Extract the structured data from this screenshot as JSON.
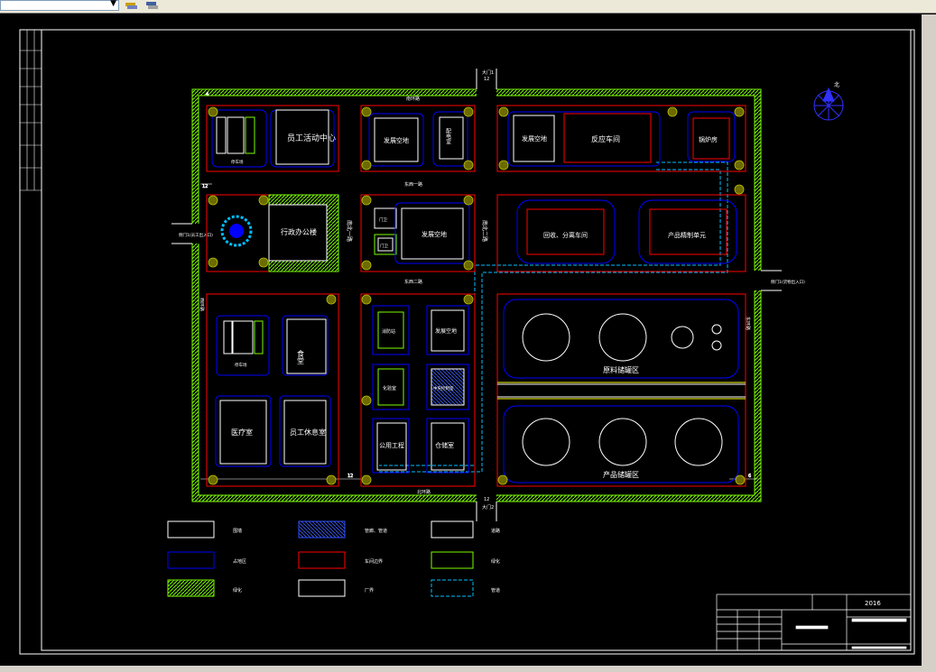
{
  "app": {
    "toolbar": {
      "layer_selector_value": "",
      "icons": [
        "layer-states-icon",
        "layer-manager-icon"
      ]
    }
  },
  "drawing": {
    "year": "2016",
    "gates": {
      "top": "大门1",
      "top_width": "12",
      "bottom": "大门2",
      "bottom_width": "12",
      "left": "侧门1(员工出入口)",
      "right": "侧门1(货物出入口)"
    },
    "roads": {
      "top": "南环路",
      "bottom": "北环路",
      "east1": "东西一路",
      "east2": "东西二路",
      "ns1": "南北一路",
      "ns2": "南北二路",
      "west": "西环路",
      "east": "东环路"
    },
    "dims": {
      "d1": "12",
      "d2": "12",
      "d3": "6",
      "d4": "12",
      "d5": "4"
    },
    "buildings": {
      "parking1": "停车场",
      "activity_center": "员工活动中心",
      "vacant1": "发展空地",
      "power_room": "配电室",
      "vacant2": "发展空地",
      "reaction": "反应车间",
      "boiler": "锅炉房",
      "admin": "行政办公楼",
      "guard1": "门卫",
      "guard2": "门卫",
      "vacant3": "发展空地",
      "recovery": "回收、分离车间",
      "packaging": "产品精制单元",
      "parking2": "停车场",
      "canteen": "食堂",
      "medical": "医疗室",
      "dorm": "员工休息室",
      "fire": "消防站",
      "vacant4": "发展空地",
      "lab": "化验室",
      "control": "中央控制室",
      "utility": "公用工程",
      "warehouse": "仓储室",
      "raw_tank": "原料储罐区",
      "product_tank": "产品储罐区"
    },
    "legend": [
      {
        "label": "围墙",
        "style": "white"
      },
      {
        "label": "管廊、管道",
        "style": "hatch-blue"
      },
      {
        "label": "道路",
        "style": "white"
      },
      {
        "label": "占地区",
        "style": "blue"
      },
      {
        "label": "车间边界",
        "style": "red"
      },
      {
        "label": "绿化",
        "style": "green-outline"
      },
      {
        "label": "绿化",
        "style": "green-hatch"
      },
      {
        "label": "厂界",
        "style": "white"
      },
      {
        "label": "管道",
        "style": "cyan-dash"
      }
    ],
    "north": "北",
    "colors": {
      "wall": "#7cfc00",
      "road": "#ffffff",
      "area": "#0000ff",
      "workshop": "#ff0000",
      "pipe": "#00bfff",
      "tree": "#a0a000",
      "tank": "#ffff00"
    }
  }
}
